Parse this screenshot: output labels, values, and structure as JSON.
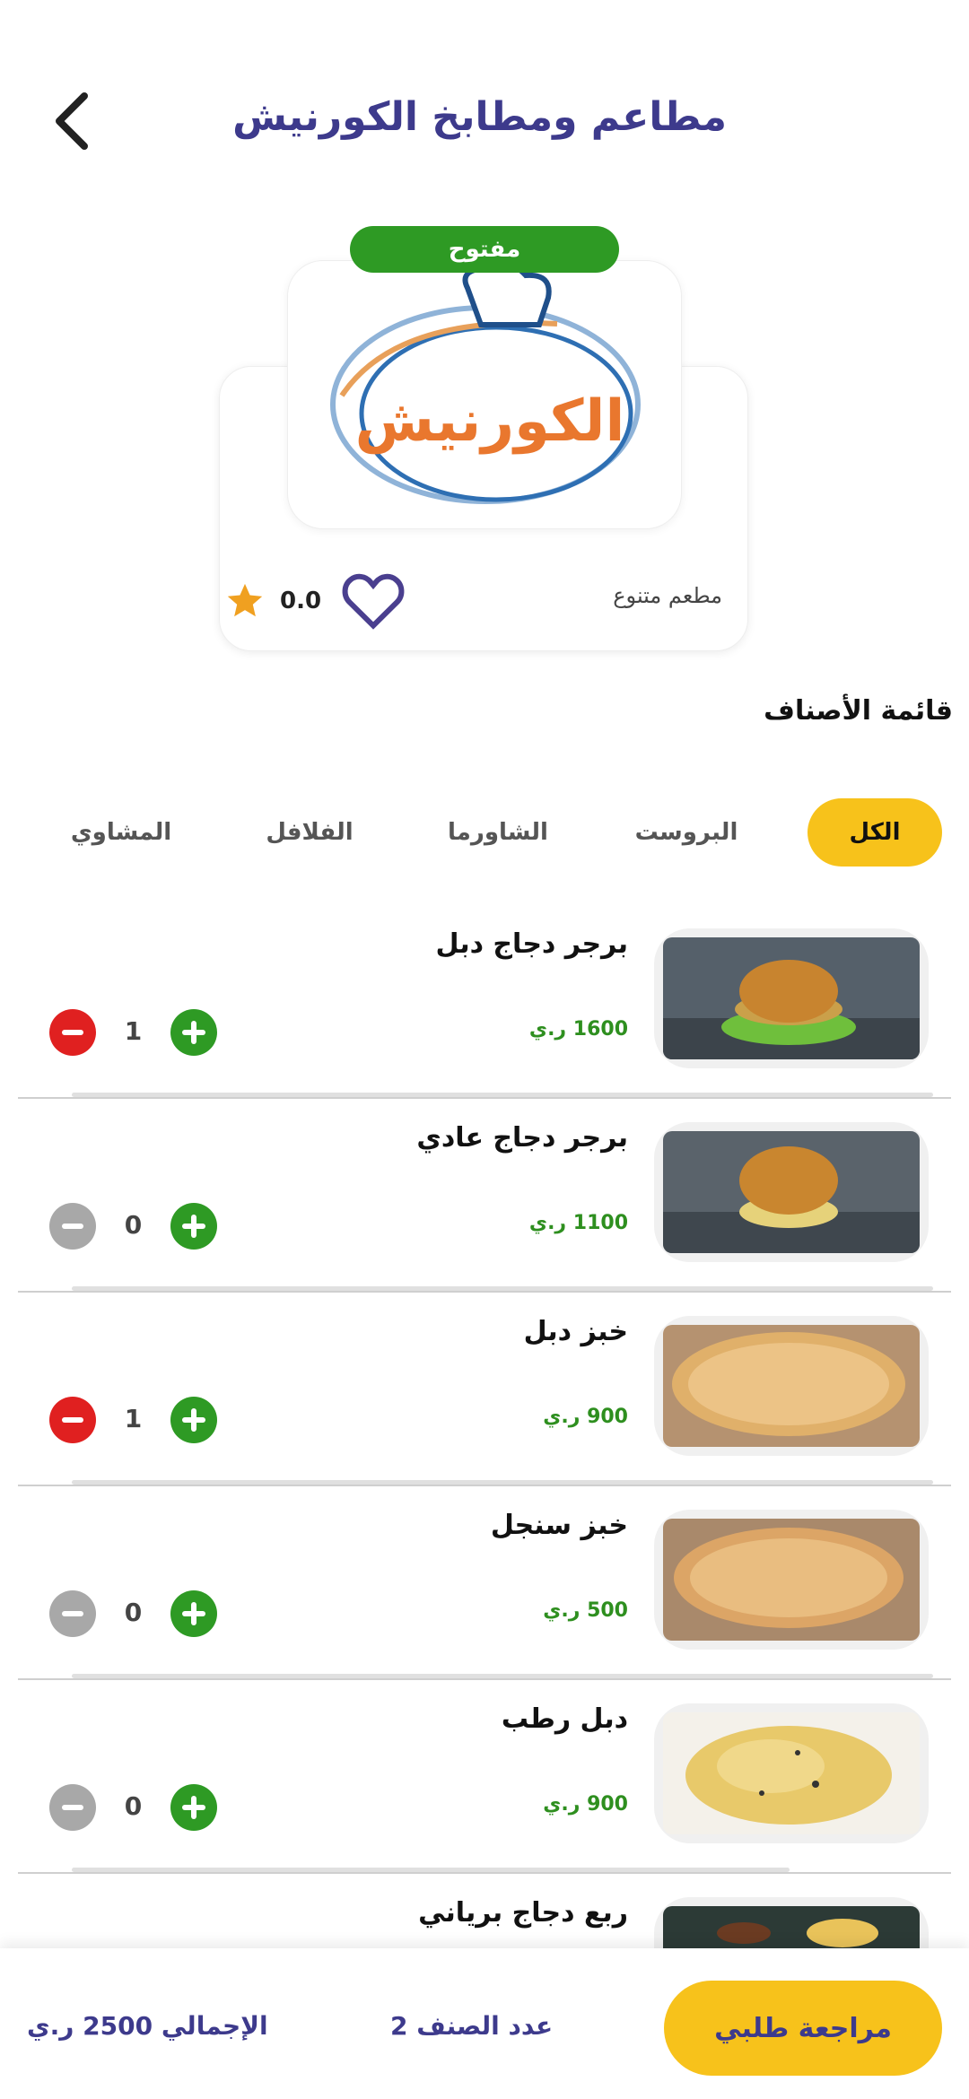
{
  "header": {
    "title": "مطاعم ومطابخ الكورنيش",
    "back_icon": "chevron-left-icon"
  },
  "restaurant": {
    "status": "مفتوح",
    "logo_text": "الكورنيش",
    "rating": "0.0",
    "type": "مطعم متنوع",
    "colors": {
      "status": "#2e9a24",
      "star": "#f0a020",
      "heart": "#4a3f8f"
    }
  },
  "categories": {
    "title": "قائمة الأصناف",
    "tabs": [
      {
        "label": "الكل",
        "active": true
      },
      {
        "label": "البروست",
        "active": false
      },
      {
        "label": "الشاورما",
        "active": false
      },
      {
        "label": "الفلافل",
        "active": false
      },
      {
        "label": "المشاوي",
        "active": false
      }
    ]
  },
  "items": [
    {
      "name": "برجر دجاج دبل",
      "price": "1600 ر.ي",
      "qty": "1"
    },
    {
      "name": "برجر دجاج عادي",
      "price": "1100 ر.ي",
      "qty": "0"
    },
    {
      "name": "خبز دبل",
      "price": "900 ر.ي",
      "qty": "1"
    },
    {
      "name": "خبز سنجل",
      "price": "500 ر.ي",
      "qty": "0"
    },
    {
      "name": "دبل رطب",
      "price": "900 ر.ي",
      "qty": "0"
    },
    {
      "name": "ربع دجاج برياني",
      "price": "",
      "qty": ""
    }
  ],
  "footer": {
    "total": "الإجمالي 2500 ر.ي",
    "count": "عدد الصنف 2",
    "review_button": "مراجعة طلبي"
  },
  "theme": {
    "accent": "#f7c21b",
    "primary": "#3d3a8c",
    "green": "#2e9a24",
    "red": "#e02020"
  }
}
